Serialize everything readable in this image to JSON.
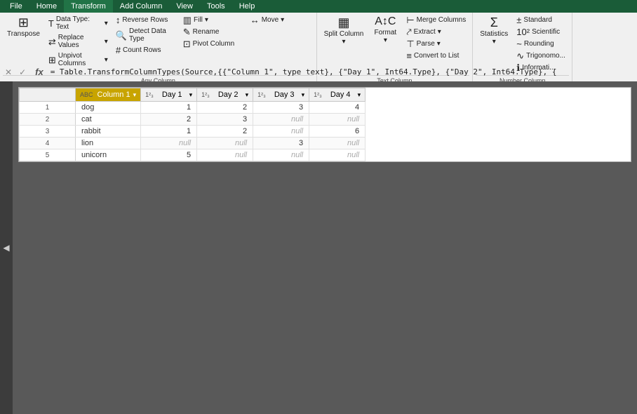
{
  "ribbon": {
    "tabs": [
      "File",
      "Home",
      "Transform",
      "Add Column",
      "View",
      "Tools",
      "Help"
    ],
    "active_tab": "Transform",
    "groups": [
      {
        "label": "Any Column",
        "items_large": [
          {
            "id": "transpose",
            "icon": "⊞",
            "label": "Transpose"
          },
          {
            "id": "split-column",
            "icon": "▦",
            "label": "Split\nColumn"
          },
          {
            "id": "format",
            "icon": "A↕C",
            "label": "Format"
          },
          {
            "id": "statistics",
            "icon": "Σ",
            "label": "Statistics"
          }
        ],
        "items_small": [
          {
            "id": "data-type",
            "icon": "T",
            "label": "Data Type: Text ▾"
          },
          {
            "id": "replace-values",
            "icon": "⇄",
            "label": "Replace Values ▾"
          },
          {
            "id": "unpivot-columns",
            "icon": "⊞",
            "label": "Unpivot Columns ▾"
          },
          {
            "id": "reverse-rows",
            "icon": "↕",
            "label": "Reverse Rows"
          },
          {
            "id": "detect-data-type",
            "icon": "🔍",
            "label": "Detect Data Type"
          },
          {
            "id": "fill",
            "icon": "▥",
            "label": "Fill ▾"
          },
          {
            "id": "move",
            "icon": "↔",
            "label": "Move ▾"
          },
          {
            "id": "count-rows",
            "icon": "#",
            "label": "Count Rows"
          },
          {
            "id": "rename",
            "icon": "✎",
            "label": "Rename"
          },
          {
            "id": "pivot-column",
            "icon": "⊡",
            "label": "Pivot Column"
          }
        ]
      }
    ],
    "group_any_column_label": "Any Column",
    "group_text_column_label": "Text Column",
    "group_number_column_label": "Number Column",
    "btns": {
      "transpose": "Transpose",
      "data_type": "Data Type: Text",
      "replace_values": "Replace Values",
      "unpivot_columns": "Unpivot Columns",
      "reverse_rows": "Reverse Rows",
      "detect_data_type": "Detect Data Type",
      "fill": "Fill",
      "move": "Move",
      "count_rows": "Count Rows",
      "rename": "Rename",
      "pivot_column": "Pivot Column",
      "split_column": "Split Column",
      "format": "Format",
      "merge_columns": "Merge Columns",
      "extract": "Extract",
      "parse": "Parse",
      "convert_to_list": "Convert to List",
      "statistics": "Statistics",
      "standard": "Standard",
      "scientific": "Scientific",
      "rounding": "Rounding",
      "trigonometry": "Trigonomo...",
      "information": "Informati..."
    }
  },
  "formula_bar": {
    "value": "= Table.TransformColumnTypes(Source,{{\"Column 1\", type text}, {\"Day 1\", Int64.Type}, {\"Day 2\", Int64.Type}, {"
  },
  "table": {
    "columns": [
      {
        "id": "col1",
        "label": "Column 1",
        "type": "ABC",
        "selected": true
      },
      {
        "id": "day1",
        "label": "Day 1",
        "type": "123"
      },
      {
        "id": "day2",
        "label": "Day 2",
        "type": "123"
      },
      {
        "id": "day3",
        "label": "Day 3",
        "type": "123"
      },
      {
        "id": "day4",
        "label": "Day 4",
        "type": "123"
      }
    ],
    "rows": [
      {
        "num": 1,
        "col1": "dog",
        "day1": "1",
        "day2": "2",
        "day3": "3",
        "day4": "4"
      },
      {
        "num": 2,
        "col1": "cat",
        "day1": "2",
        "day2": "3",
        "day3": "null",
        "day4": "null"
      },
      {
        "num": 3,
        "col1": "rabbit",
        "day1": "1",
        "day2": "2",
        "day3": "null",
        "day4": "6"
      },
      {
        "num": 4,
        "col1": "lion",
        "day1": "null",
        "day2": "null",
        "day3": "3",
        "day4": "null"
      },
      {
        "num": 5,
        "col1": "unicorn",
        "day1": "5",
        "day2": "null",
        "day3": "null",
        "day4": "null"
      }
    ]
  }
}
